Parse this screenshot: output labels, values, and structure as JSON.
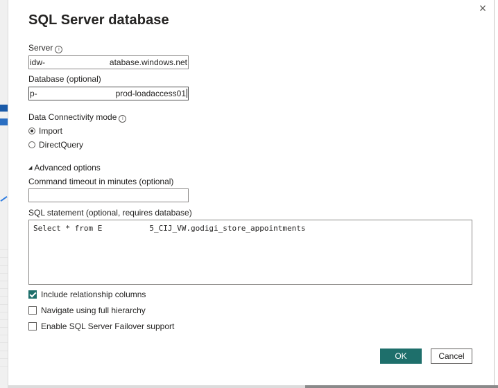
{
  "dialog": {
    "title": "SQL Server database",
    "close_icon": "×"
  },
  "server": {
    "label": "Server",
    "value_start": "idw-",
    "value_end": "atabase.windows.net"
  },
  "database": {
    "label": "Database (optional)",
    "value_start": "p-",
    "value_end": "prod-loadaccess01"
  },
  "connectivity": {
    "label": "Data Connectivity mode",
    "options": [
      {
        "label": "Import",
        "selected": true
      },
      {
        "label": "DirectQuery",
        "selected": false
      }
    ]
  },
  "advanced": {
    "toggle_label": "Advanced options",
    "timeout_label": "Command timeout in minutes (optional)",
    "timeout_value": "",
    "sql_label": "SQL statement (optional, requires database)",
    "sql_start": "Select * from E",
    "sql_end": "5_CIJ_VW.godigi_store_appointments"
  },
  "checkboxes": [
    {
      "label": "Include relationship columns",
      "checked": true
    },
    {
      "label": "Navigate using full hierarchy",
      "checked": false
    },
    {
      "label": "Enable SQL Server Failover support",
      "checked": false
    }
  ],
  "buttons": {
    "ok": "OK",
    "cancel": "Cancel"
  },
  "colors": {
    "primary": "#1e6f6b",
    "text": "#252423",
    "border": "#8a8886"
  },
  "icons": {
    "info": "i",
    "triangle": "◢"
  }
}
